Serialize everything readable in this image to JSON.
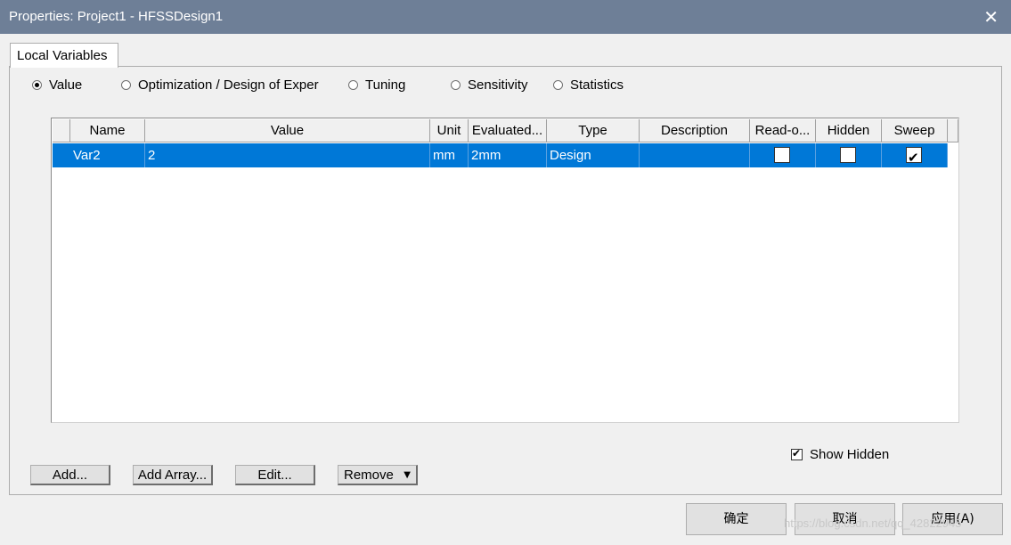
{
  "window": {
    "title": "Properties: Project1 - HFSSDesign1",
    "close_glyph": "✕"
  },
  "tabs": [
    {
      "label": "Local Variables"
    }
  ],
  "modes": [
    {
      "label": "Value",
      "selected": true
    },
    {
      "label": "Optimization / Design of Exper",
      "selected": false
    },
    {
      "label": "Tuning",
      "selected": false
    },
    {
      "label": "Sensitivity",
      "selected": false
    },
    {
      "label": "Statistics",
      "selected": false
    }
  ],
  "table": {
    "columns": [
      "Name",
      "Value",
      "Unit",
      "Evaluated...",
      "Type",
      "Description",
      "Read-o...",
      "Hidden",
      "Sweep"
    ],
    "rows": [
      {
        "name": "Var2",
        "value": "2",
        "unit": "mm",
        "evaluated": "2mm",
        "type": "Design",
        "description": "",
        "read_only": false,
        "hidden": false,
        "sweep": true
      }
    ]
  },
  "show_hidden": {
    "label": "Show Hidden",
    "checked": true
  },
  "buttons": {
    "add": "Add...",
    "add_array": "Add Array...",
    "edit": "Edit...",
    "remove": "Remove",
    "remove_arrow": "▼"
  },
  "dialog_buttons": {
    "ok": "确定",
    "cancel": "取消",
    "apply": "应用(A)"
  },
  "watermark": "https://blog.csdn.net/qq_42822945"
}
